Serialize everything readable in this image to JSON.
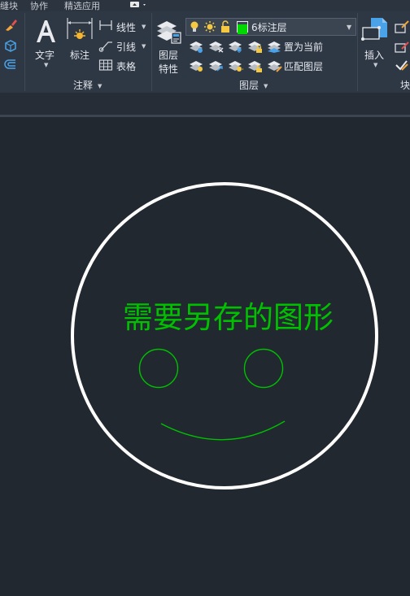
{
  "tabs": {
    "t1": "缝块",
    "t2": "协作",
    "t3": "精选应用"
  },
  "annotation_panel": {
    "text_label": "文字",
    "dim_label": "标注",
    "linear_label": "线性",
    "leader_label": "引线",
    "table_label": "表格",
    "title": "注释"
  },
  "layers_panel": {
    "props_label_1": "图层",
    "props_label_2": "特性",
    "current_layer": "6标注层",
    "set_current": "置为当前",
    "match_layer": "匹配图层",
    "title": "图层"
  },
  "block_panel": {
    "insert_label": "插入",
    "title": "块"
  },
  "drawing": {
    "text": "需要另存的图形",
    "text_color": "#00c000",
    "circle_color": "#ffffff",
    "face_color": "#00c000"
  },
  "colors": {
    "layer_swatch": "#00d800"
  }
}
